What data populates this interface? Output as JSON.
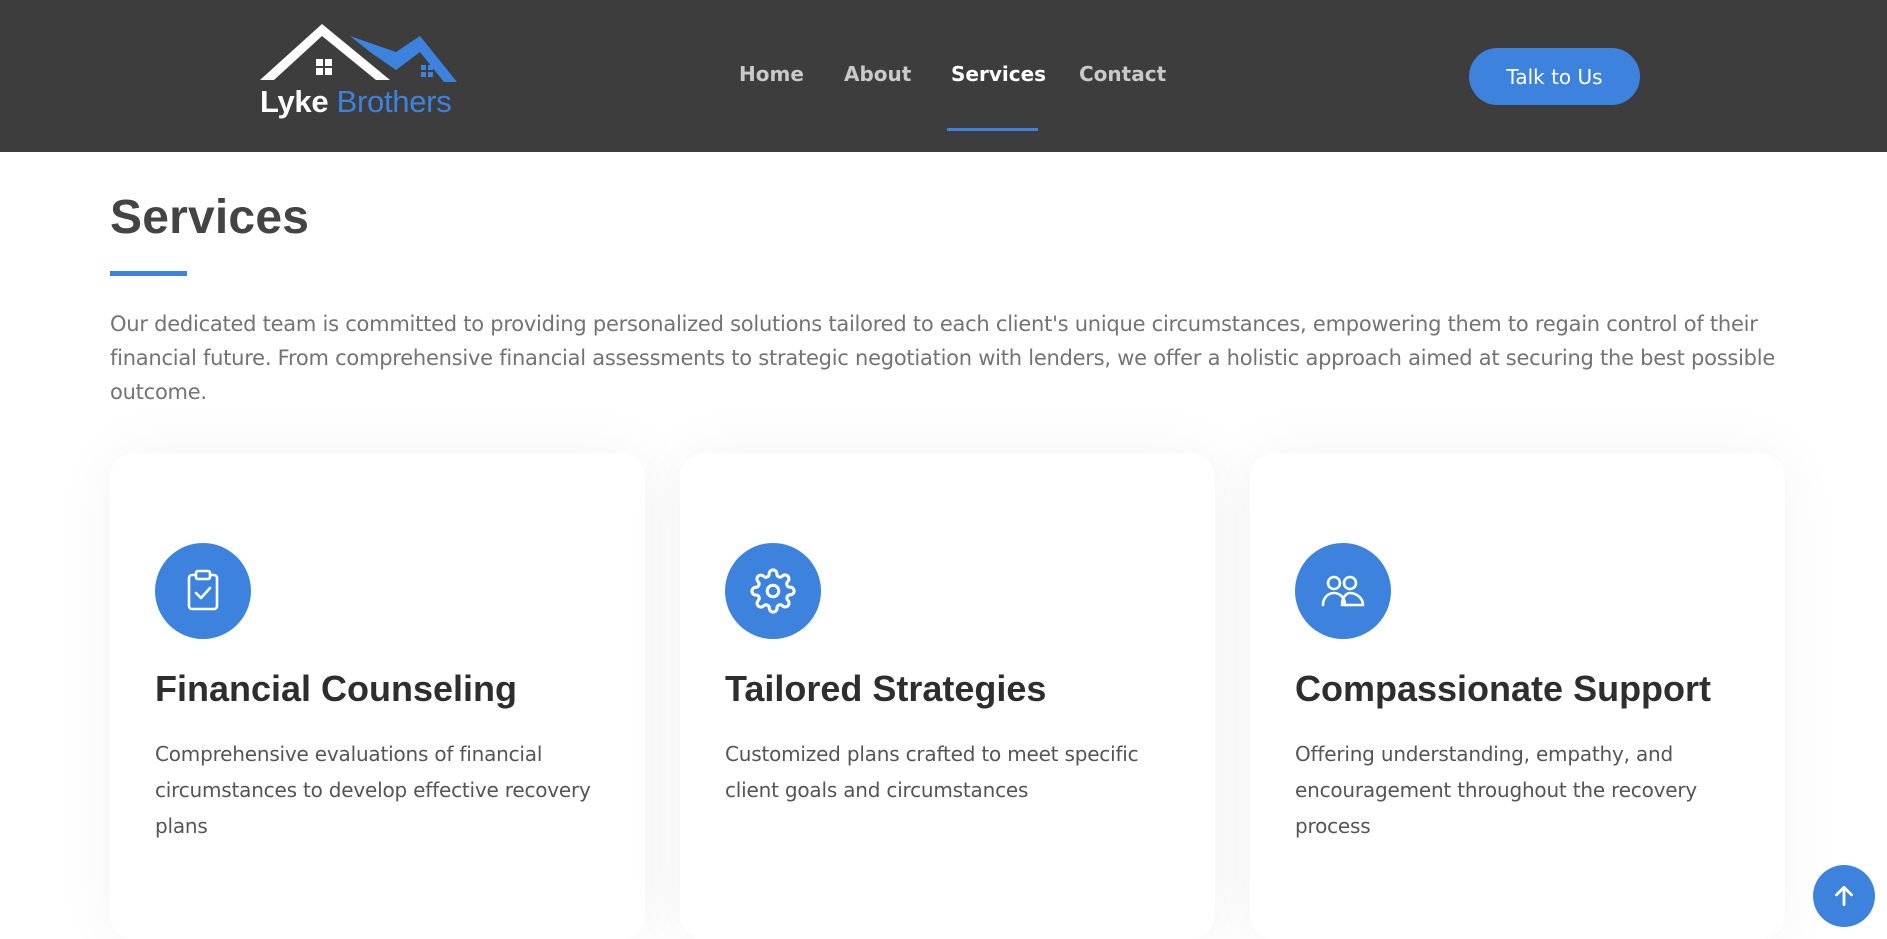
{
  "brand": {
    "name_part1": "Lyke",
    "name_part2": "Brothers",
    "colors": {
      "accent": "#3d83dd",
      "header_bg": "#3d3d3d"
    }
  },
  "nav": {
    "items": [
      {
        "label": "Home",
        "active": false
      },
      {
        "label": "About",
        "active": false
      },
      {
        "label": "Services",
        "active": true
      },
      {
        "label": "Contact",
        "active": false
      }
    ],
    "cta_label": "Talk to Us"
  },
  "main": {
    "title": "Services",
    "intro": "Our dedicated team is committed to providing personalized solutions tailored to each client's unique circumstances, empowering them to regain control of their financial future. From comprehensive financial assessments to strategic negotiation with lenders, we offer a holistic approach aimed at securing the best possible outcome.",
    "cards": [
      {
        "icon": "clipboard-check-icon",
        "title": "Financial Counseling",
        "text": "Comprehensive evaluations of financial circumstances to develop effective recovery plans"
      },
      {
        "icon": "gear-icon",
        "title": "Tailored Strategies",
        "text": "Customized plans crafted to meet specific client goals and circumstances"
      },
      {
        "icon": "users-icon",
        "title": "Compassionate Support",
        "text": "Offering understanding, empathy, and encouragement throughout the recovery process"
      }
    ]
  },
  "scroll_top": {
    "icon": "arrow-up-icon"
  }
}
